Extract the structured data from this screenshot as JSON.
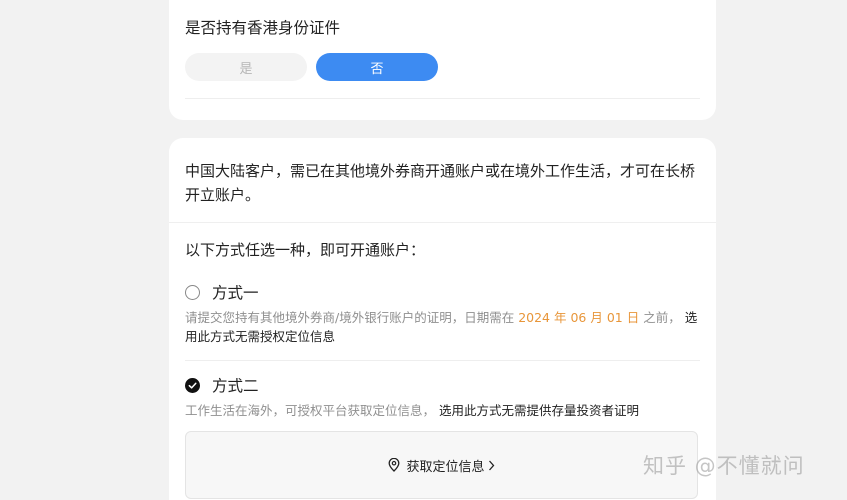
{
  "hk_id_question": {
    "title": "是否持有香港身份证件",
    "yes_label": "是",
    "no_label": "否",
    "selected": "否"
  },
  "account_info": {
    "intro": "中国大陆客户，需已在其他境外券商开通账户或在境外工作生活，才可在长桥开立账户。",
    "choose_prompt": "以下方式任选一种，即可开通账户：",
    "option1": {
      "title": "方式一",
      "checked": false,
      "desc_prefix": "请提交您持有其他境外券商/境外银行账户的证明，日期需在",
      "desc_date": "2024 年 06 月 01 日",
      "desc_middle": "之前，",
      "desc_emph": "选用此方式无需授权定位信息"
    },
    "option2": {
      "title": "方式二",
      "checked": true,
      "desc_prefix": "工作生活在海外，可授权平台获取定位信息，",
      "desc_emph": "选用此方式无需提供存量投资者证明",
      "location_button": "获取定位信息"
    }
  },
  "watermark": "知乎 @不懂就问",
  "icons": {
    "location": "location-pin-icon",
    "chevron": "chevron-right-icon",
    "check": "check-icon"
  },
  "colors": {
    "accent": "#3d8bf2",
    "highlight_date": "#e8963a",
    "muted_text": "#8f8f8f"
  }
}
